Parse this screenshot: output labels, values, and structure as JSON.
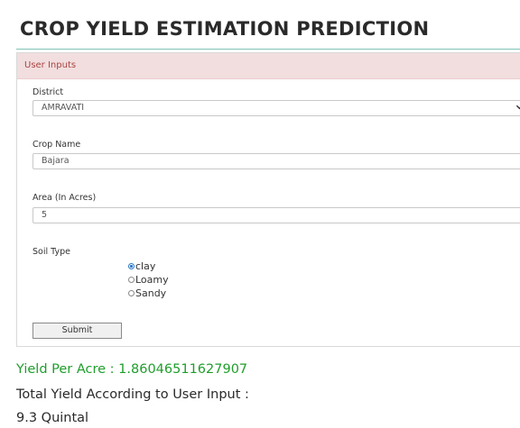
{
  "page": {
    "title": "CROP YIELD ESTIMATION PREDICTION"
  },
  "panel": {
    "heading": "User Inputs"
  },
  "form": {
    "district": {
      "label": "District",
      "value": "AMRAVATI"
    },
    "crop_name": {
      "label": "Crop Name",
      "value": "Bajara"
    },
    "area": {
      "label": "Area (In Acres)",
      "value": "5"
    },
    "soil_type": {
      "label": "Soil Type",
      "options": [
        "clay",
        "Loamy",
        "Sandy"
      ],
      "selected": "clay"
    },
    "submit_label": "Submit"
  },
  "results": {
    "yield_per_acre": "Yield Per Acre : 1.86046511627907",
    "total_yield_heading": "Total Yield According to User Input :",
    "total_yield_value": "9.3 Quintal"
  },
  "colors": {
    "heading_bg": "#f2dede",
    "heading_text": "#a94442",
    "result_green": "#1e9e2a",
    "title_rule": "#7fc3b8"
  }
}
